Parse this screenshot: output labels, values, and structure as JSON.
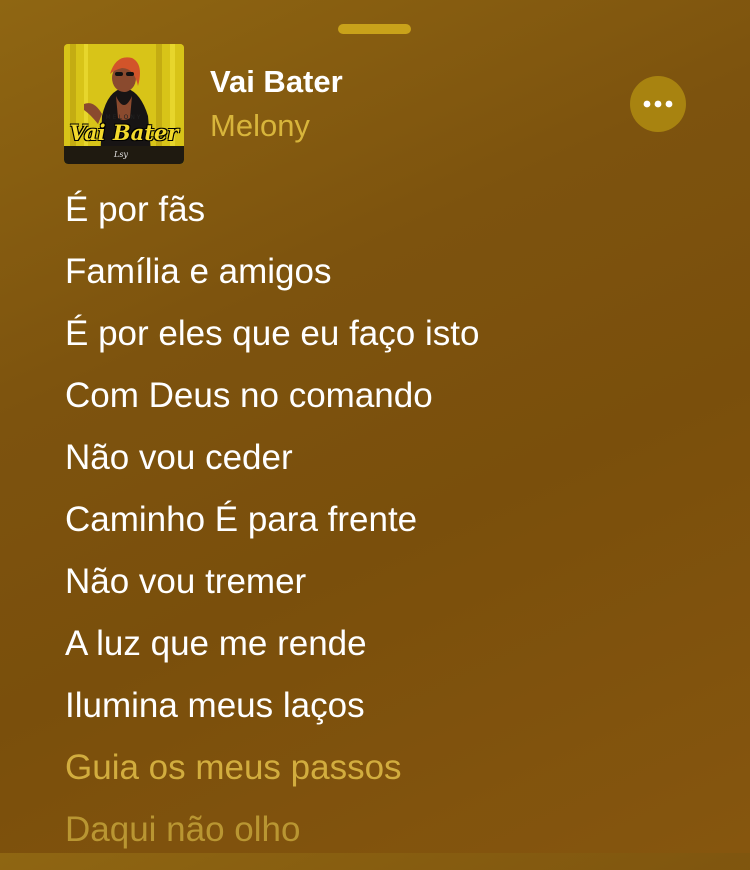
{
  "now_playing": {
    "title": "Vai Bater",
    "artist": "Melony",
    "cover_art": {
      "title": "Vai Bater",
      "artist": "MELONY",
      "signature": "Lsy"
    }
  },
  "lyrics": [
    {
      "text": "É por fãs",
      "state": "sung"
    },
    {
      "text": "Família e amigos",
      "state": "sung"
    },
    {
      "text": "É por eles que eu faço isto",
      "state": "sung"
    },
    {
      "text": "Com Deus no comando",
      "state": "sung"
    },
    {
      "text": "Não vou ceder",
      "state": "sung"
    },
    {
      "text": "Caminho É para frente",
      "state": "sung"
    },
    {
      "text": "Não vou tremer",
      "state": "sung"
    },
    {
      "text": "A luz que me rende",
      "state": "sung"
    },
    {
      "text": "Ilumina meus laços",
      "state": "sung"
    },
    {
      "text": "Guia os meus passos",
      "state": "upcoming"
    },
    {
      "text": "Daqui não olho",
      "state": "upcoming"
    }
  ],
  "icons": {
    "grabber": "drag-handle-icon",
    "more": "ellipsis-icon"
  },
  "colors": {
    "background": "#7d530e",
    "artist_text": "#d8b53b",
    "upcoming_lyric": "#d2ad3e",
    "more_button": "#a88310",
    "grabber": "#c9a21a"
  }
}
